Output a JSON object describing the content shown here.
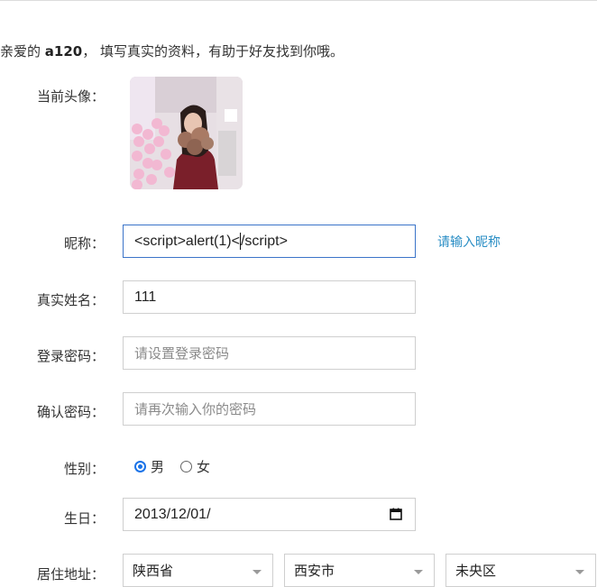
{
  "greeting": {
    "prefix": "亲爱的",
    "username": "a120",
    "suffix": "，  填写真实的资料，有助于好友找到你哦。"
  },
  "avatar": {
    "label": "当前头像："
  },
  "nickname": {
    "label": "昵称：",
    "value_before_caret": "<script>alert(1)<",
    "value_after_caret": "/script>",
    "hint": "请输入昵称"
  },
  "real_name": {
    "label": "真实姓名：",
    "value": "111"
  },
  "login_password": {
    "label": "登录密码：",
    "placeholder": "请设置登录密码"
  },
  "confirm_password": {
    "label": "确认密码：",
    "placeholder": "请再次输入你的密码"
  },
  "gender": {
    "label": "性别：",
    "options": [
      "男",
      "女"
    ],
    "selected": "男"
  },
  "birthday": {
    "label": "生日：",
    "value": "2013/12/01/"
  },
  "address": {
    "label": "居住地址：",
    "province": "陕西省",
    "city": "西安市",
    "district": "未央区"
  },
  "colors": {
    "accent": "#1a73e8",
    "hint": "#2a8ec5",
    "focus_border": "#3b74c9"
  },
  "icons": [
    "calendar-icon",
    "chevron-down-icon"
  ]
}
